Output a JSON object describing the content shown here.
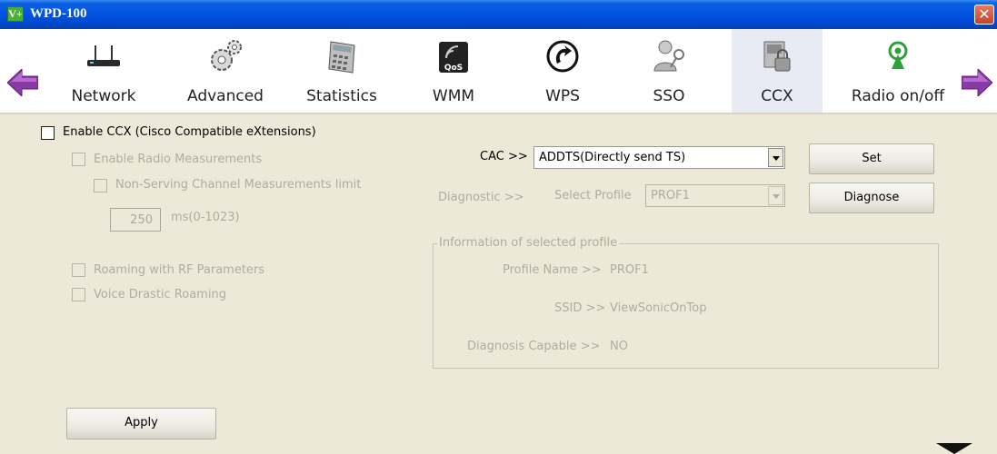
{
  "window": {
    "title": "WPD-100",
    "icon_text": "V+",
    "close_symbol": "✕"
  },
  "toolbar": {
    "items": [
      {
        "id": "network",
        "label": "Network",
        "icon": "router-icon"
      },
      {
        "id": "advanced",
        "label": "Advanced",
        "icon": "gears-icon"
      },
      {
        "id": "statistics",
        "label": "Statistics",
        "icon": "calculator-icon"
      },
      {
        "id": "wmm",
        "label": "WMM",
        "icon": "qos-icon"
      },
      {
        "id": "wps",
        "label": "WPS",
        "icon": "wps-icon"
      },
      {
        "id": "sso",
        "label": "SSO",
        "icon": "user-key-icon"
      },
      {
        "id": "ccx",
        "label": "CCX",
        "icon": "ccx-lock-icon",
        "selected": true
      },
      {
        "id": "radio",
        "label": "Radio on/off",
        "icon": "radio-antenna-icon"
      }
    ],
    "nav": {
      "left": "arrow-left-icon",
      "right": "arrow-right-icon"
    }
  },
  "ccx": {
    "enable_label": "Enable CCX (Cisco Compatible eXtensions)",
    "enable_checked": false,
    "radio_measurements_label": "Enable Radio Measurements",
    "non_serving_label": "Non-Serving Channel Measurements limit",
    "limit_value": "250",
    "limit_unit": "ms(0-1023)",
    "roaming_rf_label": "Roaming with RF Parameters",
    "voice_roaming_label": "Voice Drastic Roaming",
    "cac_label": "CAC >>",
    "cac_value": "ADDTS(Directly send TS)",
    "set_button": "Set",
    "diagnostic_label": "Diagnostic >>",
    "select_profile_label": "Select Profile",
    "profile_value": "PROF1",
    "diagnose_button": "Diagnose",
    "info_group_title": "Information of selected profile",
    "profile_name_label": "Profile Name >>",
    "profile_name_value": "PROF1",
    "ssid_label": "SSID >>",
    "ssid_value": "ViewSonicOnTop",
    "diagnosis_capable_label": "Diagnosis Capable >>",
    "diagnosis_capable_value": "NO",
    "apply_button": "Apply"
  },
  "colors": {
    "titlebar": "#0054e3",
    "panel_bg": "#ece9d8",
    "disabled_text": "#b0ac9e",
    "selected_tab": "#e8ebf4"
  }
}
